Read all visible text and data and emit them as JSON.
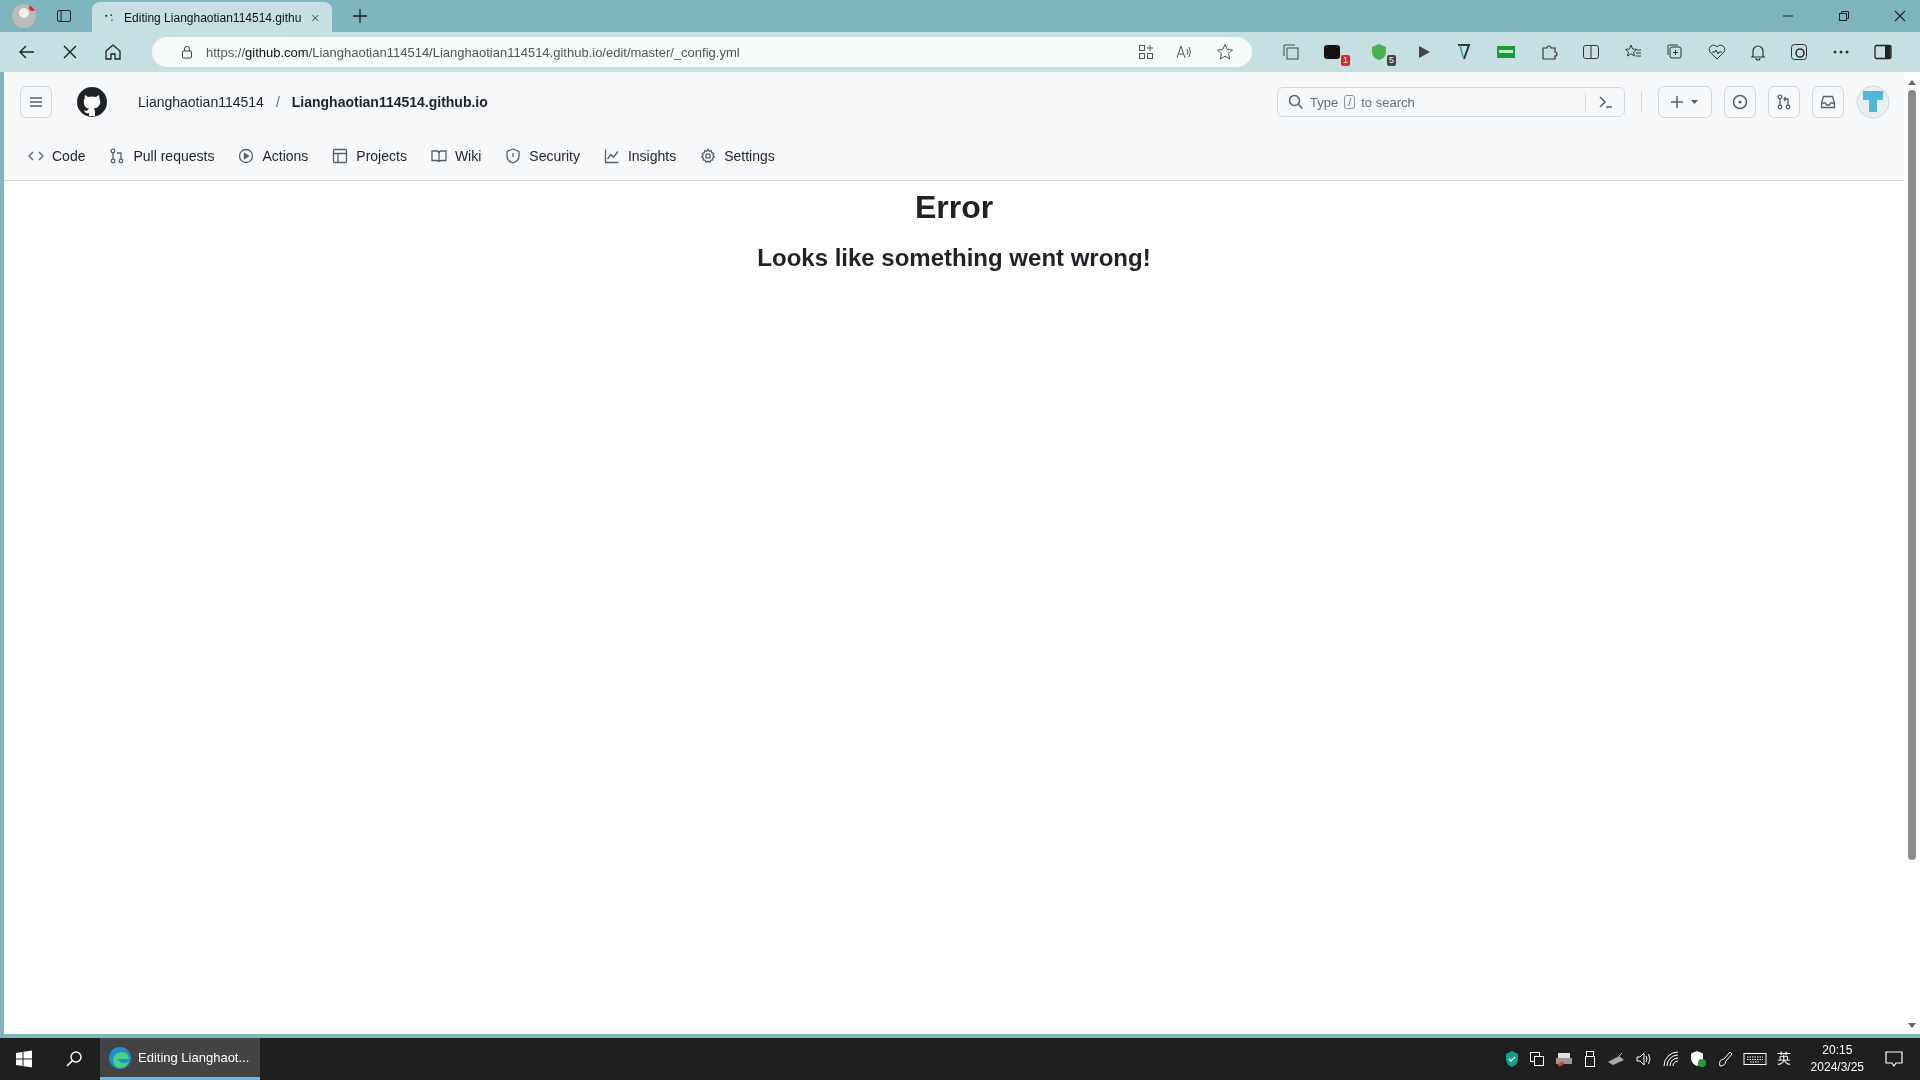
{
  "browser": {
    "tab_title": "Editing Lianghaotian114514.githu",
    "url": "https://**github.com**/Lianghaotian114514/Lianghaotian114514.github.io/edit/master/_config.yml",
    "extension_badges": [
      "1",
      "5"
    ]
  },
  "github": {
    "owner": "Lianghaotian114514",
    "separator": "/",
    "repo": "Lianghaotian114514.github.io",
    "search": {
      "before": "Type",
      "key": "/",
      "after": "to search"
    },
    "nav": [
      {
        "label": "Code"
      },
      {
        "label": "Pull requests"
      },
      {
        "label": "Actions"
      },
      {
        "label": "Projects"
      },
      {
        "label": "Wiki"
      },
      {
        "label": "Security"
      },
      {
        "label": "Insights"
      },
      {
        "label": "Settings"
      }
    ]
  },
  "error": {
    "title": "Error",
    "message": "Looks like something went wrong!"
  },
  "taskbar": {
    "app": "Editing Lianghaot...",
    "ime": "英",
    "time": "20:15",
    "date": "2024/3/25"
  }
}
